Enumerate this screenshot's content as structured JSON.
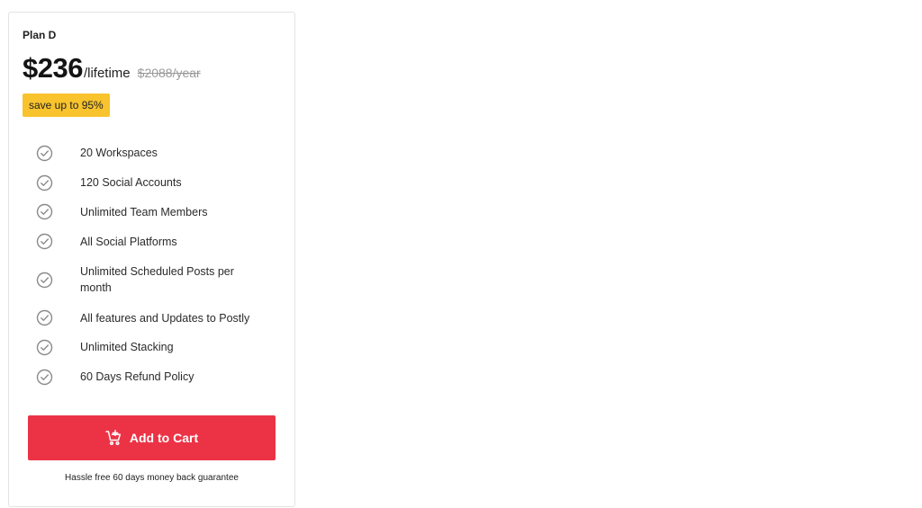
{
  "plan": {
    "name": "Plan D",
    "price": "$236",
    "period": "/lifetime",
    "old_price": "$2088/year",
    "save_badge": "save up to 95%"
  },
  "features": [
    {
      "text": "20 Workspaces",
      "icon": "check-circle-icon"
    },
    {
      "text": "120 Social Accounts",
      "icon": "check-circle-icon"
    },
    {
      "text": "Unlimited Team Members",
      "icon": "check-circle-icon"
    },
    {
      "text": "All Social Platforms",
      "icon": "check-circle-icon"
    },
    {
      "text": "Unlimited Scheduled Posts per month",
      "icon": "check-circle-icon"
    },
    {
      "text": "All features and Updates to Postly",
      "icon": "check-circle-icon"
    },
    {
      "text": "Unlimited Stacking",
      "icon": "check-circle-icon"
    },
    {
      "text": "60 Days Refund Policy",
      "icon": "check-circle-icon"
    }
  ],
  "cta": {
    "label": "Add to Cart",
    "icon": "cart-icon",
    "note": "Hassle free 60 days money back guarantee"
  },
  "colors": {
    "accent": "#ec3346",
    "badge": "#f8c32d",
    "check": "#8a8a8a"
  }
}
